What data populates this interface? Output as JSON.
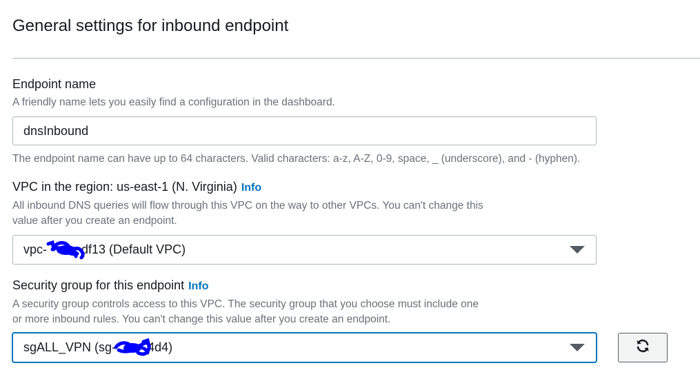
{
  "section": {
    "title": "General settings for inbound endpoint"
  },
  "endpoint_name": {
    "label": "Endpoint name",
    "description": "A friendly name lets you easily find a configuration in the dashboard.",
    "value": "dnsInbound",
    "constraint": "The endpoint name can have up to 64 characters. Valid characters: a-z, A-Z, 0-9, space, _ (underscore), and - (hyphen)."
  },
  "vpc": {
    "label": "VPC in the region: us-east-1 (N. Virginia)",
    "info_link": "Info",
    "description_line1": "All inbound DNS queries will flow through this VPC on the way to other VPCs. You can't change this",
    "description_line2": "value after you create an endpoint.",
    "selected_prefix": "vpc-",
    "selected_suffix": "df13 (Default VPC)"
  },
  "security_group": {
    "label": "Security group for this endpoint",
    "info_link": "Info",
    "description_line1": "A security group controls access to this VPC. The security group that you choose must include one",
    "description_line2": "or more inbound rules. You can't change this value after you create an endpoint.",
    "selected_prefix": "sgALL_VPN (sg-",
    "selected_suffix": "4d4)"
  },
  "icons": {
    "dropdown": "caret-down-icon",
    "refresh": "refresh-icon",
    "redaction": "redaction-scribble"
  },
  "colors": {
    "link": "#0073bb",
    "focus": "#0073bb",
    "redaction": "#0000ff"
  }
}
